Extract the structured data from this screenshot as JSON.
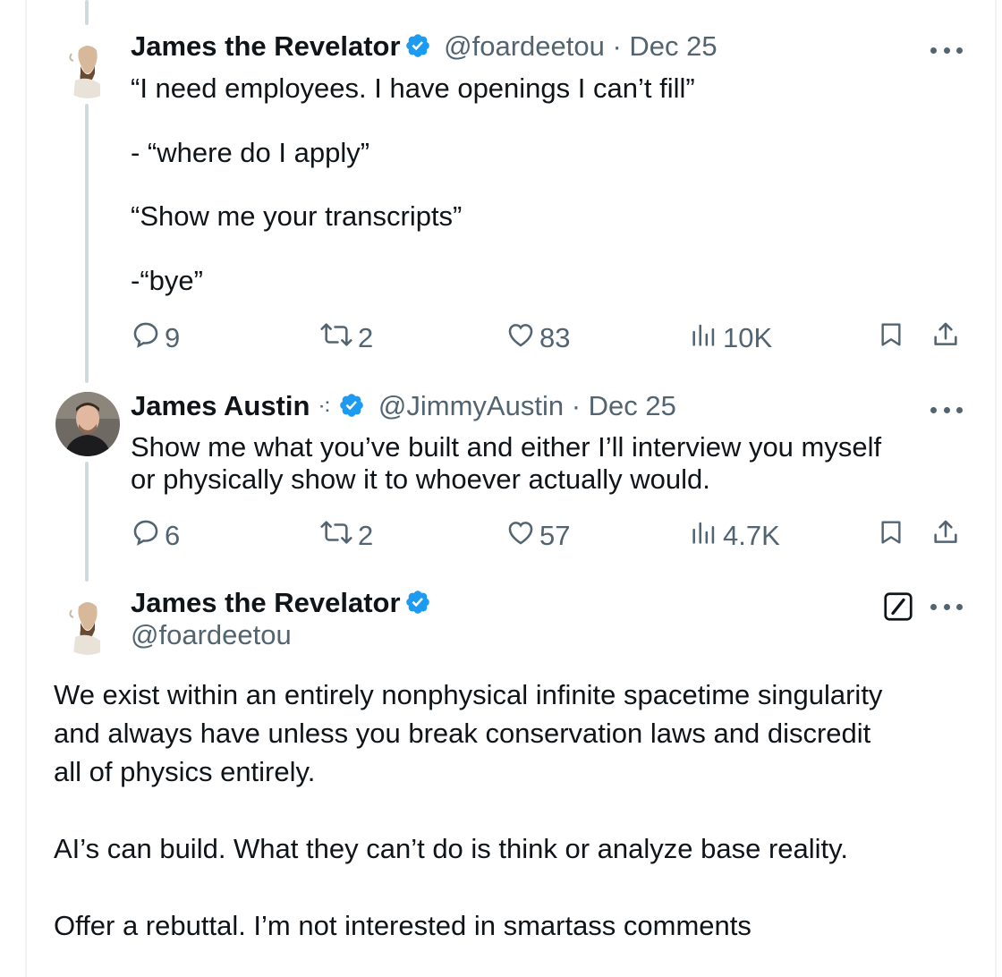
{
  "tweets": [
    {
      "name": "James the Revelator",
      "handle": "@foardeetou",
      "meta": "@foardeetou · Dec 25",
      "lines": [
        "“I need employees. I have openings I can’t fill”",
        "- “where do I apply”",
        "“Show me your transcripts”",
        "-“bye”"
      ],
      "replies": "9",
      "reposts": "2",
      "likes": "83",
      "views": "10K"
    },
    {
      "name": "James Austin",
      "name_suffix": "⁖",
      "meta": "@JimmyAustin · Dec 25",
      "lines": [
        "Show me what you’ve built and either I’ll interview you myself",
        "or physically show it to whoever actually would."
      ],
      "replies": "6",
      "reposts": "2",
      "likes": "57",
      "views": "4.7K"
    },
    {
      "name": "James the Revelator",
      "handle": "@foardeetou",
      "paragraphs": [
        "We exist within an entirely nonphysical infinite spacetime singularity",
        "and always have unless you break conservation laws and discredit",
        "all of physics entirely.",
        "AI’s can build. What they can’t do is think or analyze base reality.",
        "Offer a rebuttal. I’m not interested in smartass comments"
      ]
    }
  ],
  "colors": {
    "verified": "#1d9bf0",
    "muted": "#536471",
    "text": "#0f1419",
    "thread_line": "#cfd9de"
  },
  "icons": {
    "reply": "reply-icon",
    "repost": "repost-icon",
    "like": "heart-icon",
    "views": "views-icon",
    "bookmark": "bookmark-icon",
    "share": "share-icon",
    "more": "more-icon",
    "verified": "verified-icon",
    "edit": "edit-icon"
  }
}
